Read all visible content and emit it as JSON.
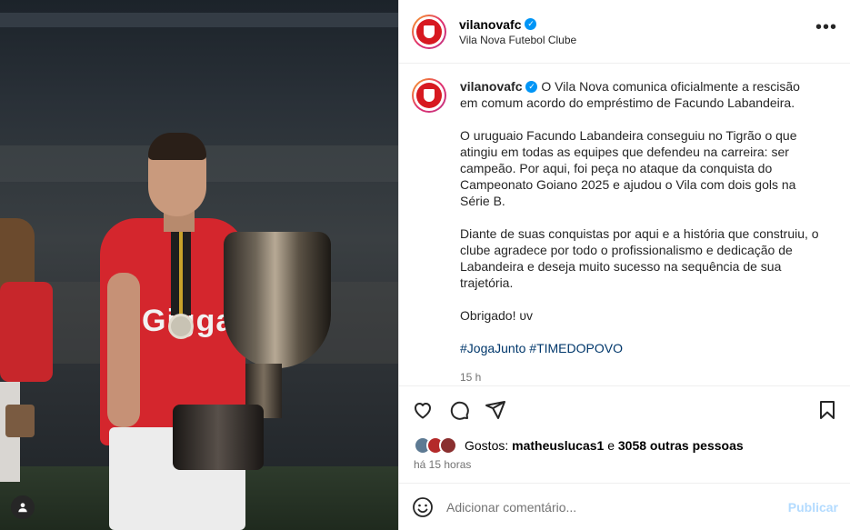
{
  "post": {
    "username": "vilanovafc",
    "subtitle": "Vila Nova Futebol Clube",
    "more_label": "•••",
    "caption_first": "O Vila Nova comunica oficialmente a rescisão em comum acordo do empréstimo de Facundo Labandeira.",
    "caption_p2": "O uruguaio Facundo Labandeira conseguiu no Tigrão o que atingiu em todas as equipes que defendeu na carreira: ser campeão. Por aqui, foi peça no ataque da conquista do Campeonato Goiano 2025 e ajudou o Vila com dois gols na Série B.",
    "caption_p3": "Diante de suas conquistas por aqui e a história que construiu, o clube agradece por todo o profissionalismo e dedicação de Labandeira e deseja muito sucesso na sequência de sua trajetória.",
    "caption_p4": "Obrigado! υv",
    "hashtags": [
      "#JogaJunto",
      "#TIMEDOPOVO"
    ],
    "caption_time": "15 h",
    "likes_prefix": "Gostos:",
    "likes_user": "matheuslucas1",
    "likes_joiner": "e",
    "likes_others": "3058 outras pessoas",
    "posted_ago": "há 15 horas",
    "comment_placeholder": "Adicionar comentário...",
    "publish_label": "Publicar"
  },
  "photo": {
    "shirt_text": "Gigga"
  },
  "colors": {
    "brand_red": "#d71920",
    "verified_blue": "#0095f6",
    "hashtag_blue": "#00376b",
    "publish_disabled": "#b3dbff"
  },
  "icons": [
    "heart-icon",
    "comment-icon",
    "share-icon",
    "bookmark-icon",
    "emoji-icon",
    "user-icon",
    "verified-icon",
    "more-icon"
  ]
}
